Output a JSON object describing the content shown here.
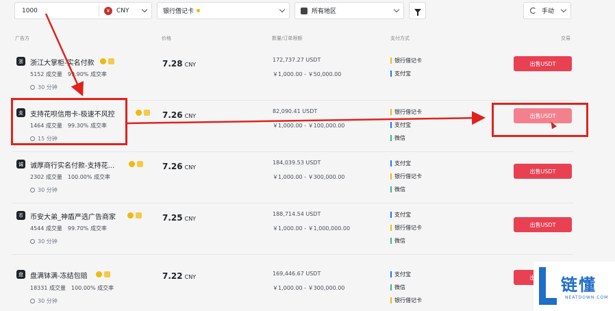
{
  "filters": {
    "amount": "1000",
    "currency": "CNY",
    "payment": "银行借记卡",
    "region": "所有地区",
    "refresh": "手动"
  },
  "headers": {
    "advertiser": "广告方",
    "price": "价格",
    "amount": "数量/订单限额",
    "payment": "支付方式",
    "trade": "交易"
  },
  "ads": [
    {
      "name": "浙江大掌柜-实名付款",
      "orders": "5152 成交量",
      "rate": "99.90% 成交率",
      "time": "30 分钟",
      "price": "7.28",
      "unit": "CNY",
      "qty": "172,737.27 USDT",
      "limit": "￥1,000.00 - ￥50,000.00",
      "payments": [
        "银行借记卡",
        "支付宝"
      ],
      "button": "出售USDT"
    },
    {
      "name": "支持花呗信用卡-极速不风控",
      "orders": "1464 成交量",
      "rate": "99.30% 成交率",
      "time": "15 分钟",
      "price": "7.26",
      "unit": "CNY",
      "qty": "82,090.41 USDT",
      "limit": "￥1,000.00 - ￥100,000.00",
      "payments": [
        "银行借记卡",
        "支付宝",
        "微信"
      ],
      "button": "出售USDT"
    },
    {
      "name": "诚厚商行实名付款-支持花...",
      "orders": "2302 成交量",
      "rate": "100.00% 成交率",
      "time": "30 分钟",
      "price": "7.26",
      "unit": "CNY",
      "qty": "184,039.53 USDT",
      "limit": "￥1,000.00 - ￥300,000.00",
      "payments": [
        "支付宝",
        "银行借记卡",
        "微信"
      ],
      "button": "出售USDT"
    },
    {
      "name": "币安大弟_神盾严选广告商家",
      "orders": "4544 成交量",
      "rate": "99.70% 成交率",
      "time": "30 分钟",
      "price": "7.25",
      "unit": "CNY",
      "qty": "188,714.54 USDT",
      "limit": "￥1,000.00 - ￥1,000,000.00",
      "payments": [
        "支付宝",
        "银行借记卡",
        "微信"
      ],
      "button": "出售USDT"
    },
    {
      "name": "盘满钵满-冻结包赔",
      "orders": "18331 成交量",
      "rate": "100.00% 成交率",
      "time": "30 分钟",
      "price": "7.22",
      "unit": "CNY",
      "qty": "169,446.67 USDT",
      "limit": "￥1,000.00 - ￥300,000.00",
      "payments": [
        "支付宝",
        "微信",
        "银行借记卡"
      ],
      "button": "出售USDT"
    }
  ],
  "colors": {
    "sell": "#e84152",
    "annotation": "#e0221b",
    "bank_bar": "#f0b90b",
    "alipay_bar": "#1677ff",
    "wechat_bar": "#2ebd85"
  },
  "watermark": {
    "cn": "链懂",
    "en": "NEATDOWN.COM"
  }
}
